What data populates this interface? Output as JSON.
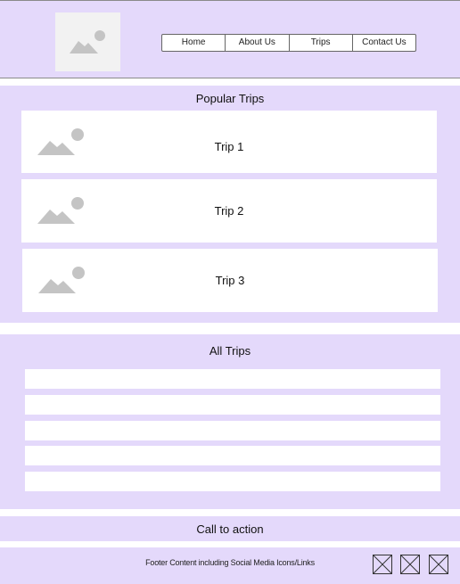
{
  "header": {
    "logo_icon": "image-placeholder-icon",
    "nav": [
      {
        "label": "Home"
      },
      {
        "label": "About Us"
      },
      {
        "label": "Trips"
      },
      {
        "label": "Contact Us"
      }
    ]
  },
  "popular": {
    "title": "Popular Trips",
    "trips": [
      {
        "label": "Trip 1",
        "icon": "image-placeholder-icon"
      },
      {
        "label": "Trip 2",
        "icon": "image-placeholder-icon"
      },
      {
        "label": "Trip 3",
        "icon": "image-placeholder-icon"
      }
    ]
  },
  "all_trips": {
    "title": "All Trips",
    "row_count": 5
  },
  "cta": {
    "label": "Call to action"
  },
  "footer": {
    "text": "Footer Content including Social Media Icons/Links",
    "social_icons": [
      "social-placeholder-icon",
      "social-placeholder-icon",
      "social-placeholder-icon"
    ]
  },
  "colors": {
    "band": "#e4d9fb",
    "placeholder_gray": "#c4c4c4",
    "card": "#ffffff"
  }
}
